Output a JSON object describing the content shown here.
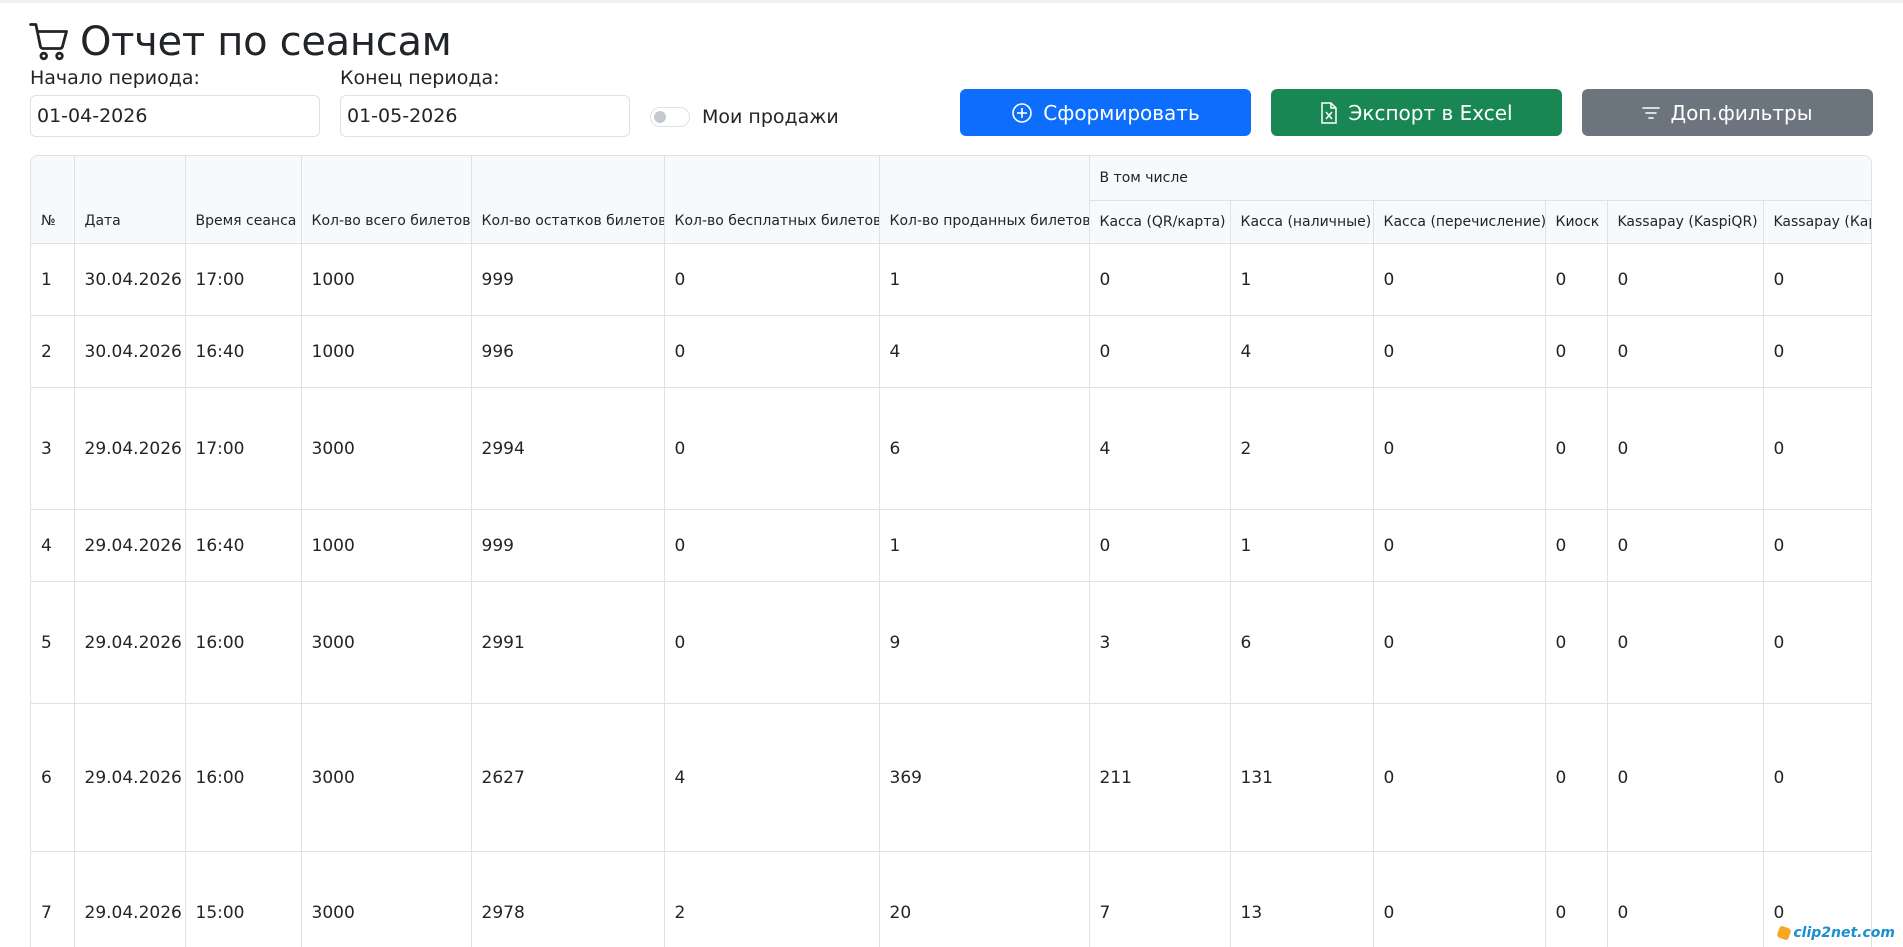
{
  "page": {
    "title": "Отчет по сеансам",
    "icon": "cart-icon"
  },
  "filters": {
    "start_label": "Начало периода:",
    "start_value": "01-04-2026",
    "end_label": "Конец периода:",
    "end_value": "01-05-2026",
    "my_sales_label": "Мои продажи",
    "my_sales_checked": false
  },
  "actions": {
    "generate_label": "Сформировать",
    "export_label": "Экспорт в Excel",
    "filters_label": "Доп.фильтры",
    "colors": {
      "primary": "#0d6efd",
      "success": "#198754",
      "secondary": "#6c757d"
    }
  },
  "table": {
    "group_label": "В том числе",
    "columns": {
      "num": "№",
      "date": "Дата",
      "time": "Время сеанса",
      "total": "Кол-во всего билетов",
      "remaining": "Кол-во остатков билетов",
      "free": "Кол-во бесплатных билетов",
      "sold": "Кол-во проданных билетов",
      "qr": "Касса (QR/карта)",
      "cash": "Касса (наличные)",
      "transfer": "Касса (перечисление)",
      "kiosk": "Киоск",
      "kaspiqr": "Kassapay (KaspiQR)",
      "kassapay_card": "Kassapay (Кар"
    },
    "rows": [
      {
        "num": "1",
        "date": "30.04.2026",
        "time": "17:00",
        "total": "1000",
        "remaining": "999",
        "free": "0",
        "sold": "1",
        "qr": "0",
        "cash": "1",
        "transfer": "0",
        "kiosk": "0",
        "kaspiqr": "0",
        "kassapay_card": "0"
      },
      {
        "num": "2",
        "date": "30.04.2026",
        "time": "16:40",
        "total": "1000",
        "remaining": "996",
        "free": "0",
        "sold": "4",
        "qr": "0",
        "cash": "4",
        "transfer": "0",
        "kiosk": "0",
        "kaspiqr": "0",
        "kassapay_card": "0"
      },
      {
        "num": "3",
        "date": "29.04.2026",
        "time": "17:00",
        "total": "3000",
        "remaining": "2994",
        "free": "0",
        "sold": "6",
        "qr": "4",
        "cash": "2",
        "transfer": "0",
        "kiosk": "0",
        "kaspiqr": "0",
        "kassapay_card": "0"
      },
      {
        "num": "4",
        "date": "29.04.2026",
        "time": "16:40",
        "total": "1000",
        "remaining": "999",
        "free": "0",
        "sold": "1",
        "qr": "0",
        "cash": "1",
        "transfer": "0",
        "kiosk": "0",
        "kaspiqr": "0",
        "kassapay_card": "0"
      },
      {
        "num": "5",
        "date": "29.04.2026",
        "time": "16:00",
        "total": "3000",
        "remaining": "2991",
        "free": "0",
        "sold": "9",
        "qr": "3",
        "cash": "6",
        "transfer": "0",
        "kiosk": "0",
        "kaspiqr": "0",
        "kassapay_card": "0"
      },
      {
        "num": "6",
        "date": "29.04.2026",
        "time": "16:00",
        "total": "3000",
        "remaining": "2627",
        "free": "4",
        "sold": "369",
        "qr": "211",
        "cash": "131",
        "transfer": "0",
        "kiosk": "0",
        "kaspiqr": "0",
        "kassapay_card": "0"
      },
      {
        "num": "7",
        "date": "29.04.2026",
        "time": "15:00",
        "total": "3000",
        "remaining": "2978",
        "free": "2",
        "sold": "20",
        "qr": "7",
        "cash": "13",
        "transfer": "0",
        "kiosk": "0",
        "kaspiqr": "0",
        "kassapay_card": "0"
      }
    ]
  },
  "watermark": "clip2net.com"
}
